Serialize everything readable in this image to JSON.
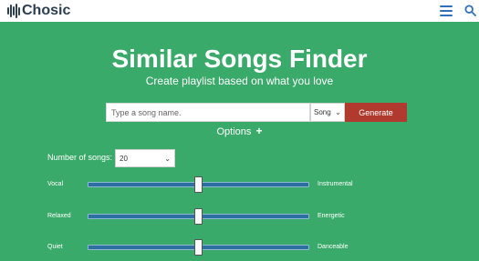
{
  "header": {
    "logo_text": "Chosic",
    "menu_icon": "hamburger-menu-icon",
    "search_icon": "search-icon"
  },
  "hero": {
    "title": "Similar Songs Finder",
    "subtitle": "Create playlist based on what you love"
  },
  "search": {
    "placeholder": "Type a song name.",
    "value": "",
    "type_selected": "Song",
    "generate_label": "Generate"
  },
  "options": {
    "label": "Options",
    "toggle_icon": "plus-icon"
  },
  "settings": {
    "num_songs_label": "Number of songs:",
    "num_songs_value": "20"
  },
  "sliders": [
    {
      "left_label": "Vocal",
      "right_label": "Instrumental",
      "value": 0.5
    },
    {
      "left_label": "Relaxed",
      "right_label": "Energetic",
      "value": 0.5
    },
    {
      "left_label": "Quiet",
      "right_label": "Danceable",
      "value": 0.5
    }
  ],
  "colors": {
    "background": "#3aaa6a",
    "generate_button": "#b03a2e",
    "slider_track": "#2d6fa0",
    "logo": "#2d3e50",
    "icon_blue": "#2f6fb7"
  }
}
